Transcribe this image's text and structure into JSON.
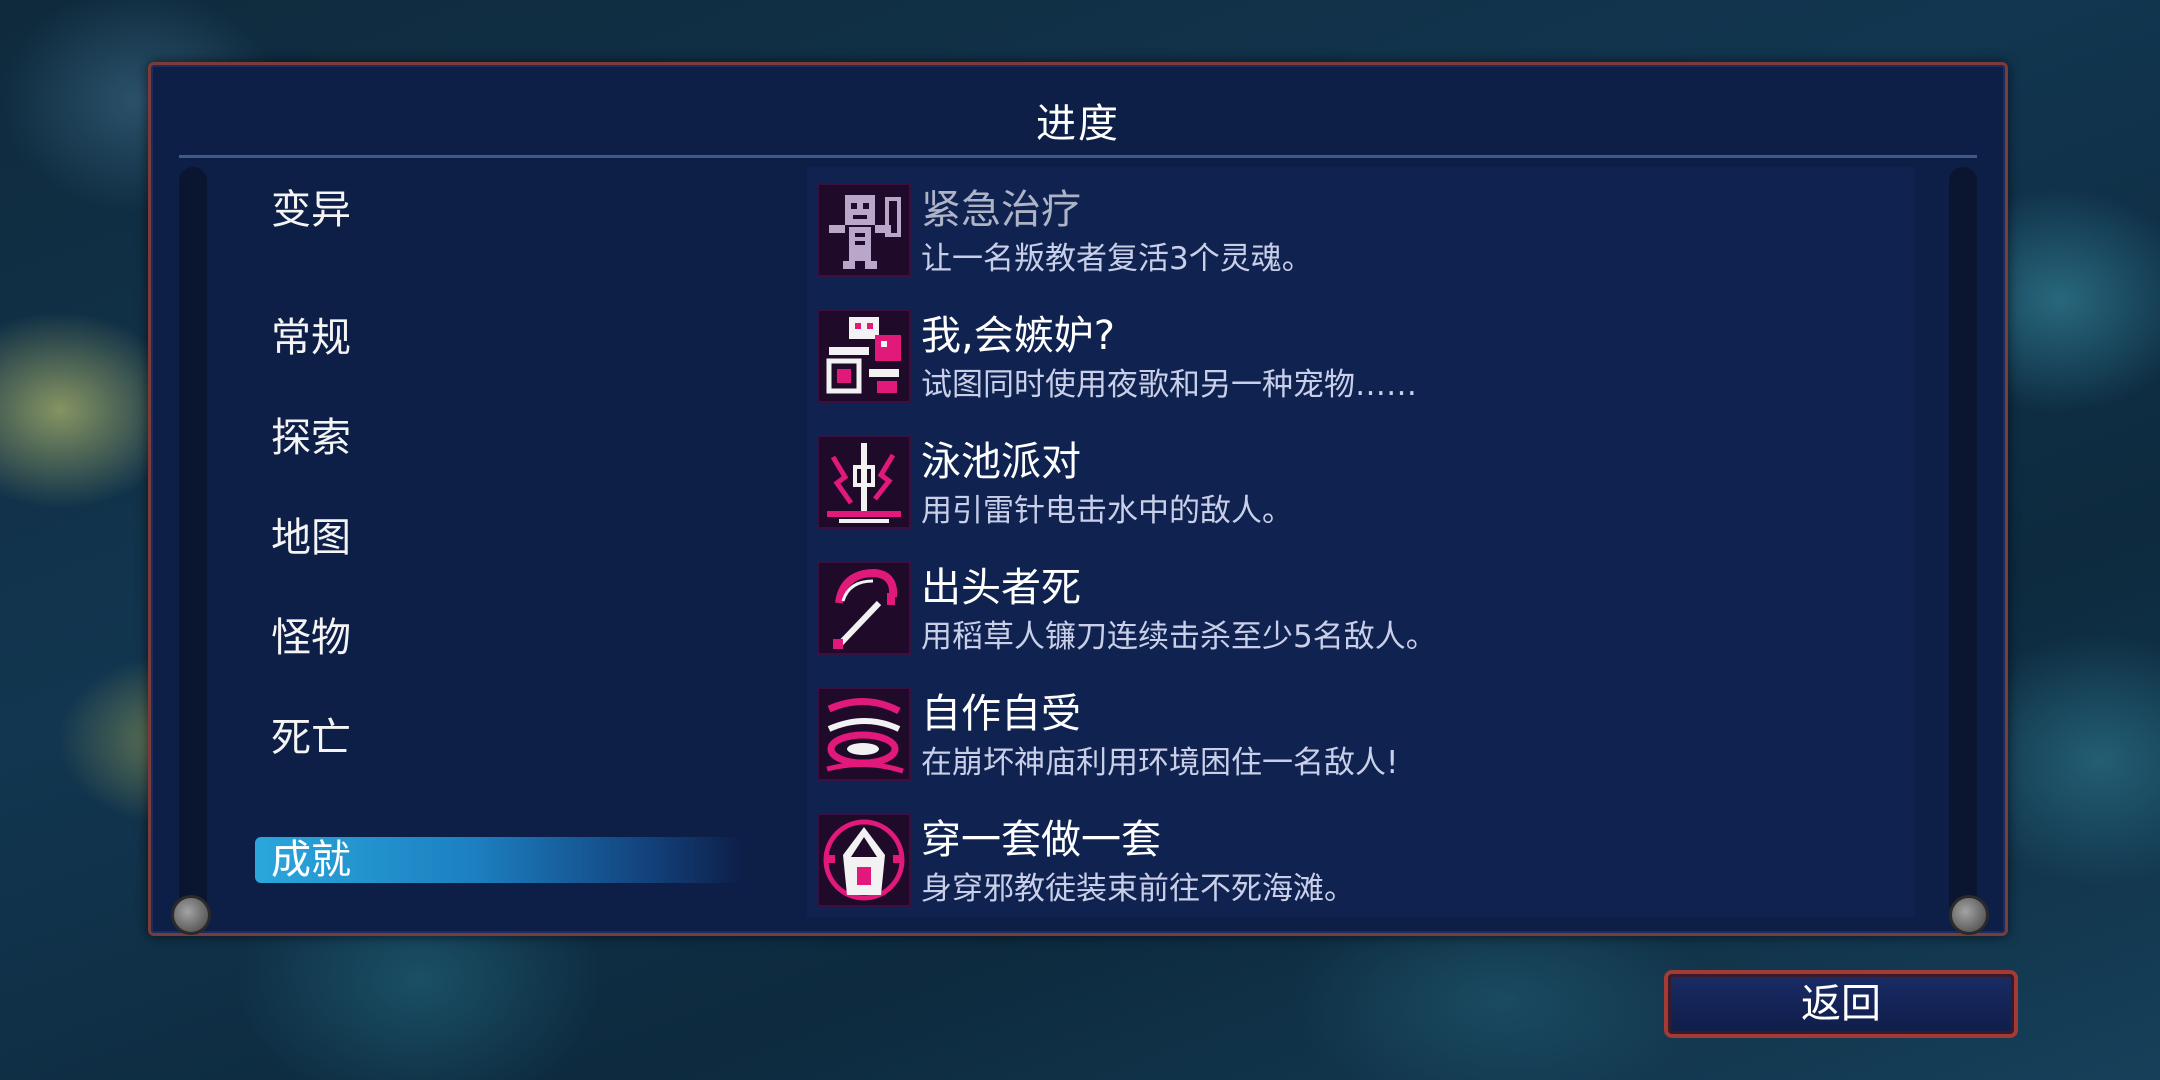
{
  "panel": {
    "title": "进度"
  },
  "categories": [
    {
      "label": "变异"
    },
    {
      "label": "常规"
    },
    {
      "label": "探索"
    },
    {
      "label": "地图"
    },
    {
      "label": "怪物"
    },
    {
      "label": "死亡"
    }
  ],
  "active_category": {
    "label": "成就"
  },
  "achievements": [
    {
      "title": "紧急治疗",
      "desc": "让一名叛教者复活3个灵魂。",
      "icon": "medkit-skeleton-icon",
      "locked": true
    },
    {
      "title": "我,会嫉妒?",
      "desc": "试图同时使用夜歌和另一种宠物……",
      "icon": "pet-owl-icon",
      "locked": false
    },
    {
      "title": "泳池派对",
      "desc": "用引雷针电击水中的敌人。",
      "icon": "lightning-rod-icon",
      "locked": false
    },
    {
      "title": "出头者死",
      "desc": "用稻草人镰刀连续击杀至少5名敌人。",
      "icon": "scythe-icon",
      "locked": false
    },
    {
      "title": "自作自受",
      "desc": "在崩坏神庙利用环境困住一名敌人!",
      "icon": "trap-swirl-icon",
      "locked": false
    },
    {
      "title": "穿一套做一套",
      "desc": "身穿邪教徒装束前往不死海滩。",
      "icon": "cultist-hood-icon",
      "locked": false
    }
  ],
  "footer": {
    "back_label": "返回"
  },
  "colors": {
    "icon_accent": "#e0197a",
    "active_tab": "#2aa7dc",
    "frame": "#a23a35"
  }
}
